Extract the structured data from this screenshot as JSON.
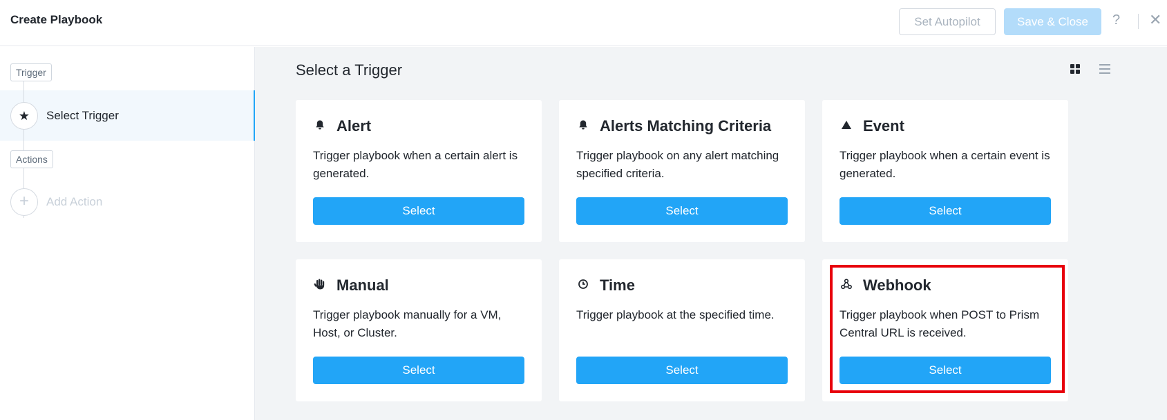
{
  "header": {
    "title": "Create Playbook",
    "autopilot_label": "Set Autopilot",
    "save_label": "Save & Close",
    "help_glyph": "?",
    "close_glyph": "✕"
  },
  "sidebar": {
    "trigger_tag": "Trigger",
    "select_trigger_label": "Select Trigger",
    "actions_tag": "Actions",
    "add_action_label": "Add Action"
  },
  "main": {
    "title": "Select a Trigger",
    "view_toggle": {
      "grid_icon": "grid-view-icon",
      "list_icon": "list-view-icon",
      "active": "grid"
    },
    "cards": [
      {
        "name": "Alert",
        "icon": "bell-icon",
        "description": "Trigger playbook when a certain alert is generated.",
        "button": "Select"
      },
      {
        "name": "Alerts Matching Criteria",
        "icon": "bell-icon",
        "description": "Trigger playbook on any alert matching specified criteria.",
        "button": "Select"
      },
      {
        "name": "Event",
        "icon": "triangle-icon",
        "description": "Trigger playbook when a certain event is generated.",
        "button": "Select"
      },
      {
        "name": "Manual",
        "icon": "hand-icon",
        "description": "Trigger playbook manually for a VM, Host, or Cluster.",
        "button": "Select"
      },
      {
        "name": "Time",
        "icon": "clock-icon",
        "description": "Trigger playbook at the specified time.",
        "button": "Select"
      },
      {
        "name": "Webhook",
        "icon": "webhook-icon",
        "description": "Trigger playbook when POST to Prism Central URL is received.",
        "button": "Select"
      }
    ]
  },
  "colors": {
    "accent": "#22a5f7",
    "accent_disabled": "#b3dcfa",
    "highlight": "#e8000b",
    "main_bg": "#f2f4f6"
  }
}
